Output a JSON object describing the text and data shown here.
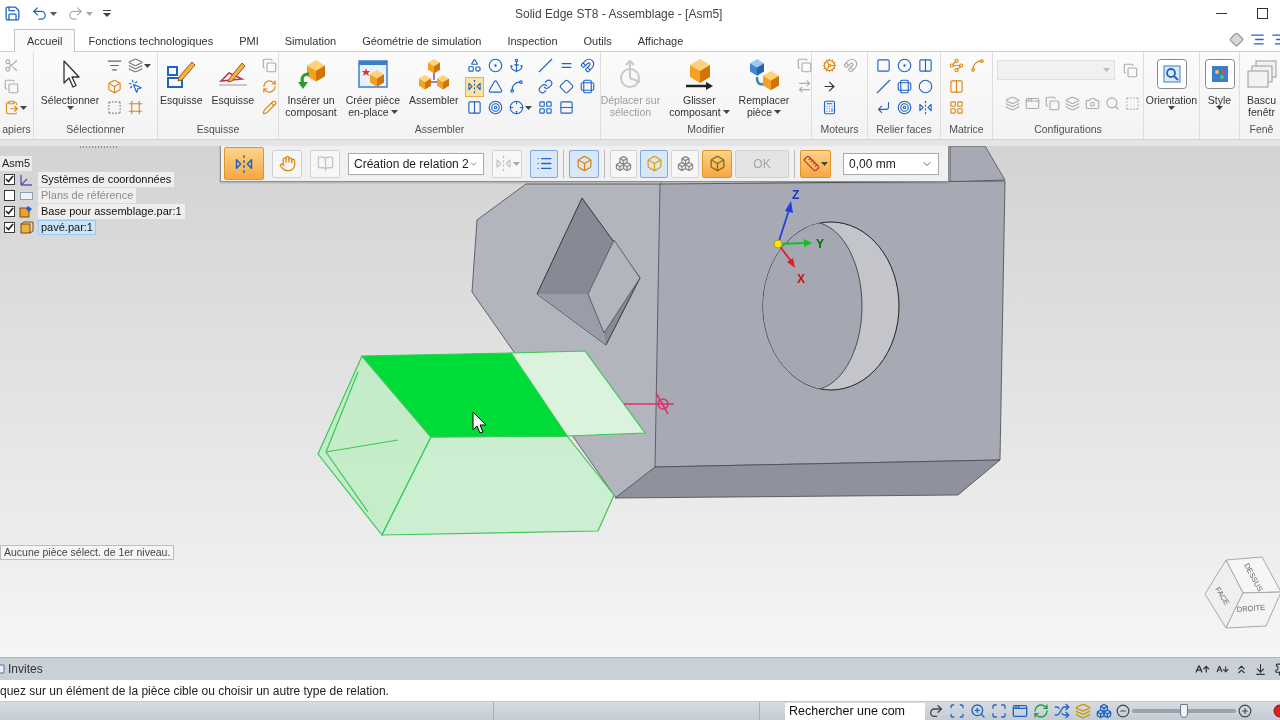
{
  "title_bar": {
    "title": "Solid Edge ST8 - Assemblage - [Asm5]",
    "quick_access": [
      {
        "disabled": false,
        "menu": false
      },
      {
        "disabled": false,
        "menu": true
      },
      {
        "disabled": true,
        "menu": true
      }
    ]
  },
  "ribbon_tabs": [
    {
      "label": "Accueil",
      "selected": true
    },
    {
      "label": "Fonctions technologiques",
      "selected": false
    },
    {
      "label": "PMI",
      "selected": false
    },
    {
      "label": "Simulation",
      "selected": false
    },
    {
      "label": "Géométrie de simulation",
      "selected": false
    },
    {
      "label": "Inspection",
      "selected": false
    },
    {
      "label": "Outils",
      "selected": false
    },
    {
      "label": "Affichage",
      "selected": false
    }
  ],
  "ribbon_groups": [
    {
      "kind": "tools",
      "label": "apiers",
      "tools": [
        {
          "selected": false,
          "disabled": true,
          "menu": false
        },
        {
          "selected": false,
          "disabled": true,
          "menu": false
        },
        {
          "selected": false,
          "disabled": false,
          "menu": true
        }
      ]
    },
    {
      "kind": "tools",
      "label": "Sélectionner",
      "buttons": [
        {
          "lines": [
            "Sélectionner"
          ],
          "menu": true,
          "disabled": false
        }
      ],
      "tools": [
        {
          "selected": false,
          "disabled": false,
          "menu": false
        },
        {
          "selected": false,
          "disabled": false,
          "menu": false
        },
        {
          "selected": false,
          "disabled": false,
          "menu": false
        },
        {
          "selected": false,
          "disabled": false,
          "menu": true
        },
        {
          "selected": false,
          "disabled": false,
          "menu": false
        },
        {
          "selected": false,
          "disabled": false,
          "menu": false
        }
      ]
    },
    {
      "kind": "tools",
      "label": "Esquisse",
      "buttons": [
        {
          "lines": [
            "Esquisse"
          ],
          "menu": false,
          "disabled": false
        },
        {
          "lines": [
            "Esquisse"
          ],
          "menu": false,
          "disabled": false
        }
      ],
      "tools": [
        {
          "selected": false,
          "disabled": true,
          "menu": false
        },
        {
          "selected": false,
          "disabled": false,
          "menu": false
        },
        {
          "selected": false,
          "disabled": false,
          "menu": false
        }
      ]
    },
    {
      "kind": "tools",
      "label": "Assembler",
      "buttons": [
        {
          "lines": [
            "Insérer un",
            "composant"
          ],
          "menu": false,
          "disabled": false
        },
        {
          "lines": [
            "Créer pièce",
            "en-place"
          ],
          "menu": true,
          "disabled": false
        },
        {
          "lines": [
            "Assembler"
          ],
          "menu": false,
          "disabled": false
        }
      ],
      "tools": [
        {
          "selected": false,
          "disabled": false,
          "menu": false
        },
        {
          "selected": true,
          "disabled": false,
          "menu": false
        },
        {
          "selected": false,
          "disabled": false,
          "menu": false
        },
        {
          "selected": false,
          "disabled": false,
          "menu": false
        },
        {
          "selected": false,
          "disabled": false,
          "menu": false
        },
        {
          "selected": false,
          "disabled": false,
          "menu": false
        },
        {
          "selected": false,
          "disabled": false,
          "menu": false
        },
        {
          "selected": false,
          "disabled": false,
          "menu": false
        },
        {
          "selected": false,
          "disabled": false,
          "menu": true
        },
        {
          "selected": false,
          "disabled": false,
          "menu": false
        },
        {
          "selected": false,
          "disabled": false,
          "menu": false
        },
        {
          "selected": false,
          "disabled": false,
          "menu": false
        },
        {
          "selected": false,
          "disabled": false,
          "menu": false
        },
        {
          "selected": false,
          "disabled": false,
          "menu": false
        },
        {
          "selected": false,
          "disabled": false,
          "menu": false
        },
        {
          "selected": false,
          "disabled": false,
          "menu": false
        },
        {
          "selected": false,
          "disabled": false,
          "menu": false
        }
      ]
    },
    {
      "kind": "tools",
      "label": "Modifier",
      "buttons": [
        {
          "lines": [
            "Déplacer sur",
            "sélection"
          ],
          "menu": false,
          "disabled": true
        },
        {
          "lines": [
            "Glisser",
            "composant"
          ],
          "menu": true,
          "disabled": false
        },
        {
          "lines": [
            "Remplacer",
            "pièce"
          ],
          "menu": true,
          "disabled": false
        }
      ],
      "tools": [
        {
          "selected": false,
          "disabled": true,
          "menu": false
        },
        {
          "selected": false,
          "disabled": true,
          "menu": false
        }
      ]
    },
    {
      "kind": "tools",
      "label": "Moteurs",
      "tools": [
        {
          "selected": false,
          "disabled": false,
          "menu": false
        },
        {
          "selected": false,
          "disabled": false,
          "menu": false
        },
        {
          "selected": false,
          "disabled": false,
          "menu": false
        },
        {
          "selected": false,
          "disabled": true,
          "menu": false
        }
      ]
    },
    {
      "kind": "tools",
      "label": "Relier faces",
      "tools": [
        {
          "selected": false,
          "disabled": false,
          "menu": false
        },
        {
          "selected": false,
          "disabled": false,
          "menu": false
        },
        {
          "selected": false,
          "disabled": false,
          "menu": false
        },
        {
          "selected": false,
          "disabled": false,
          "menu": false
        },
        {
          "selected": false,
          "disabled": false,
          "menu": false
        },
        {
          "selected": false,
          "disabled": false,
          "menu": false
        },
        {
          "selected": false,
          "disabled": false,
          "menu": false
        },
        {
          "selected": false,
          "disabled": false,
          "menu": false
        },
        {
          "selected": false,
          "disabled": false,
          "menu": false
        }
      ]
    },
    {
      "kind": "tools",
      "label": "Matrice",
      "tools": [
        {
          "selected": false,
          "disabled": false,
          "menu": false
        },
        {
          "selected": false,
          "disabled": false,
          "menu": false
        },
        {
          "selected": false,
          "disabled": false,
          "menu": false
        },
        {
          "selected": false,
          "disabled": false,
          "menu": false
        }
      ]
    },
    {
      "kind": "combo_row",
      "label": "Configurations",
      "combo": {
        "disabled": true
      },
      "tools": [
        {
          "selected": false,
          "disabled": true,
          "menu": false
        },
        {
          "selected": false,
          "disabled": true,
          "menu": false
        },
        {
          "selected": false,
          "disabled": true,
          "menu": false
        },
        {
          "selected": false,
          "disabled": true,
          "menu": false
        },
        {
          "selected": false,
          "disabled": true,
          "menu": false
        },
        {
          "selected": false,
          "disabled": true,
          "menu": false
        },
        {
          "selected": false,
          "disabled": true,
          "menu": false
        },
        {
          "selected": false,
          "disabled": true,
          "menu": false
        }
      ]
    },
    {
      "kind": "tools",
      "buttons": [
        {
          "lines": [
            "Orientation"
          ],
          "menu": true,
          "disabled": false
        }
      ]
    },
    {
      "kind": "tools",
      "buttons": [
        {
          "lines": [
            "Style"
          ],
          "menu": true,
          "disabled": false
        }
      ]
    },
    {
      "kind": "tools",
      "label": "Fenê",
      "buttons": [
        {
          "lines": [
            "Bascu",
            "fenêtr"
          ],
          "menu": false,
          "disabled": false
        }
      ]
    }
  ],
  "command_bar": {
    "groups": [
      [
        {
          "kind": "tool",
          "selected": true,
          "disabled": false
        },
        {
          "kind": "tool",
          "selected": false,
          "disabled": false
        },
        {
          "kind": "tool",
          "selected": false,
          "disabled": true
        },
        {
          "kind": "select",
          "value": "Création de relation 2"
        },
        {
          "kind": "split",
          "selected": false,
          "disabled": true
        },
        {
          "kind": "toggle",
          "checked": true,
          "disabled": false
        }
      ],
      [
        {
          "kind": "toggle",
          "checked": true,
          "disabled": false
        }
      ],
      [
        {
          "kind": "tool",
          "selected": false,
          "disabled": false
        },
        {
          "kind": "toggle",
          "checked": true,
          "disabled": false
        },
        {
          "kind": "tool",
          "selected": false,
          "disabled": false
        },
        {
          "kind": "tool",
          "selected": true,
          "disabled": false
        },
        {
          "kind": "button",
          "label": "OK",
          "disabled": true
        }
      ],
      [
        {
          "kind": "split",
          "selected": true,
          "disabled": false
        },
        {
          "kind": "select",
          "value": "0,00 mm"
        }
      ]
    ]
  },
  "tree": {
    "root": "Asm5",
    "items": [
      {
        "label": "Systèmes de coordonnées",
        "checked": true,
        "selected": false
      },
      {
        "label": "Plans de référence",
        "checked": false,
        "selected": false
      },
      {
        "label": "Base pour assemblage.par:1",
        "checked": true,
        "selected": false
      },
      {
        "label": "pavé.par:1",
        "checked": true,
        "selected": true
      }
    ]
  },
  "triad": {
    "z": "Z",
    "y": "Y",
    "x": "X"
  },
  "viewport_message": "Aucune pièce sélect. de 1er niveau.",
  "view_cube": {
    "top": "DESSUS",
    "front": "FACE",
    "right": "DROITE"
  },
  "prompt_panel": {
    "title": "Invites",
    "message": "quez sur un élément de la pièce cible ou choisir un autre type de relation."
  },
  "status_bar": {
    "search": {
      "placeholder": "Rechercher une com"
    },
    "zoom": {
      "level": 0.5
    }
  }
}
